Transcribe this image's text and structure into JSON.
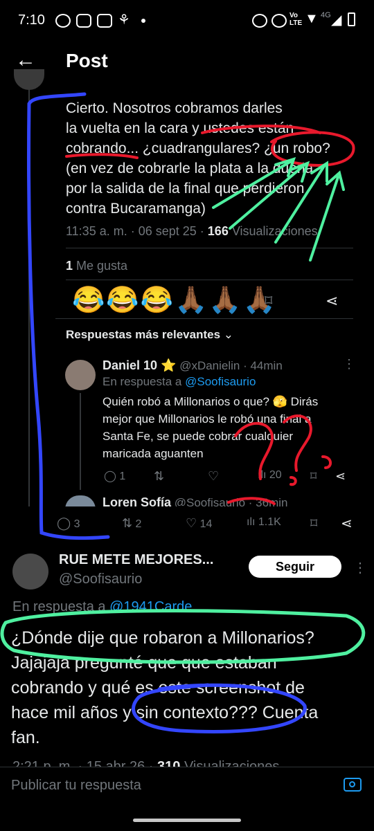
{
  "status_bar": {
    "time": "7:10",
    "signal_label": "4G"
  },
  "header": {
    "title": "Post"
  },
  "main_post": {
    "text_lines": [
      "Cierto. Nosotros cobramos darles",
      "la vuelta en la cara y ustedes están",
      "cobrando... ¿cuadrangulares? ¿un robo?",
      "(en vez de cobrarle la plata a la dueña",
      "por la salida de la final que perdieron",
      "contra Bucaramanga)"
    ],
    "timestamp": "11:35 a. m. · 06 sept 25 ·",
    "views_count": "166",
    "views_label": "Visualizaciones",
    "likes_count": "1",
    "likes_label": "Me gusta",
    "emojis": [
      "😂",
      "😂",
      "😂",
      "🙏🏾",
      "🙏🏾",
      "🙏🏾"
    ]
  },
  "replies_sort": {
    "label": "Respuestas más relevantes"
  },
  "reply_1": {
    "name": "Daniel 10 ⭐",
    "handle": "@xDanielin · 44min",
    "reply_to_prefix": "En respuesta a",
    "reply_to_handle": "@Soofisaurio",
    "text_lines": [
      "Quién robó a Millonarios o que? 🫣 Dirás",
      "mejor que Millonarios le robó una final a",
      "Santa Fe, se puede cobrar cualquier",
      "maricada aguanten"
    ],
    "reply_count": "1",
    "views_count": "20"
  },
  "reply_2": {
    "name": "Loren Sofía",
    "handle": "@Soofisaurio · 36min"
  },
  "thread_actions": {
    "replies": "3",
    "reposts": "2",
    "likes": "14",
    "views": "1.1K"
  },
  "author": {
    "display_name": "RUE METE MEJORES...",
    "handle": "@Soofisaurio",
    "follow_label": "Seguir"
  },
  "reply_post": {
    "reply_to_prefix": "En respuesta a",
    "reply_to_handle": "@1941Carde",
    "text_lines": [
      "¿Dónde dije que robaron a Millonarios?",
      "Jajajaja pregunté que que estaban",
      "cobrando y qué es este screenshot de",
      "hace mil años y sin contexto??? Cuenta",
      "fan."
    ],
    "timestamp": "2:21 p. m. · 15 abr 26 ·",
    "views_count": "310",
    "views_label": "Visualizaciones"
  },
  "composer": {
    "placeholder": "Publicar tu respuesta"
  },
  "colors": {
    "accent": "#1d9bf0",
    "annotation_blue": "#3346ff",
    "annotation_red": "#e8192c",
    "annotation_green": "#4ff0a0"
  }
}
